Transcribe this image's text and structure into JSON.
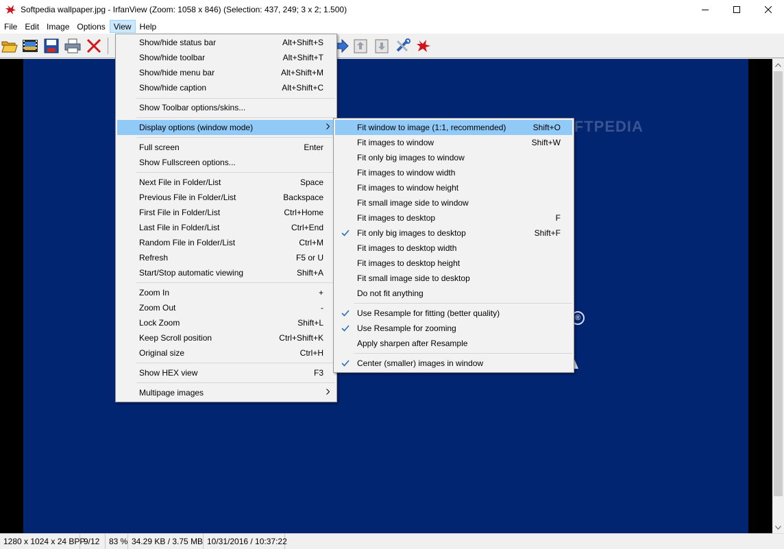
{
  "titlebar": {
    "title": "Softpedia wallpaper.jpg - IrfanView (Zoom: 1058 x 846) (Selection: 437, 249; 3 x 2; 1.500)"
  },
  "menubar": [
    "File",
    "Edit",
    "Image",
    "Options",
    "View",
    "Help"
  ],
  "toolbar": {
    "icons": [
      "open-folder-icon",
      "slideshow-icon",
      "save-icon",
      "print-icon",
      "delete-icon",
      "next-arrow-icon",
      "copy-icon",
      "paste-icon",
      "tools-icon",
      "irfanview-icon"
    ]
  },
  "view_menu": [
    {
      "label": "Show/hide status bar",
      "shortcut": "Alt+Shift+S"
    },
    {
      "label": "Show/hide toolbar",
      "shortcut": "Alt+Shift+T"
    },
    {
      "label": "Show/hide menu bar",
      "shortcut": "Alt+Shift+M"
    },
    {
      "label": "Show/hide caption",
      "shortcut": "Alt+Shift+C"
    },
    {
      "label": "Show Toolbar options/skins...",
      "shortcut": ""
    },
    {
      "label": "Display options (window mode)",
      "shortcut": ""
    },
    {
      "label": "Full screen",
      "shortcut": "Enter"
    },
    {
      "label": "Show Fullscreen options...",
      "shortcut": ""
    },
    {
      "label": "Next File in Folder/List",
      "shortcut": "Space"
    },
    {
      "label": "Previous File in Folder/List",
      "shortcut": "Backspace"
    },
    {
      "label": "First File in Folder/List",
      "shortcut": "Ctrl+Home"
    },
    {
      "label": "Last File in Folder/List",
      "shortcut": "Ctrl+End"
    },
    {
      "label": "Random File in Folder/List",
      "shortcut": "Ctrl+M"
    },
    {
      "label": "Refresh",
      "shortcut": "F5 or U"
    },
    {
      "label": "Start/Stop automatic viewing",
      "shortcut": "Shift+A"
    },
    {
      "label": "Zoom In",
      "shortcut": "+"
    },
    {
      "label": "Zoom Out",
      "shortcut": "-"
    },
    {
      "label": "Lock Zoom",
      "shortcut": "Shift+L"
    },
    {
      "label": "Keep Scroll position",
      "shortcut": "Ctrl+Shift+K"
    },
    {
      "label": "Original size",
      "shortcut": "Ctrl+H"
    },
    {
      "label": "Show HEX view",
      "shortcut": "F3"
    },
    {
      "label": "Multipage images",
      "shortcut": ""
    }
  ],
  "display_submenu": [
    {
      "label": "Fit window to image (1:1, recommended)",
      "shortcut": "Shift+O",
      "checked": false
    },
    {
      "label": "Fit images to window",
      "shortcut": "Shift+W",
      "checked": false
    },
    {
      "label": "Fit only big images to window",
      "shortcut": "",
      "checked": false
    },
    {
      "label": "Fit images to window width",
      "shortcut": "",
      "checked": false
    },
    {
      "label": "Fit images to window height",
      "shortcut": "",
      "checked": false
    },
    {
      "label": "Fit small image side to window",
      "shortcut": "",
      "checked": false
    },
    {
      "label": "Fit images to desktop",
      "shortcut": "F",
      "checked": false
    },
    {
      "label": "Fit only big images to desktop",
      "shortcut": "Shift+F",
      "checked": true
    },
    {
      "label": "Fit images to desktop width",
      "shortcut": "",
      "checked": false
    },
    {
      "label": "Fit images to desktop height",
      "shortcut": "",
      "checked": false
    },
    {
      "label": "Fit small image side to desktop",
      "shortcut": "",
      "checked": false
    },
    {
      "label": "Do not fit anything",
      "shortcut": "",
      "checked": false
    },
    {
      "label": "Use Resample for fitting (better quality)",
      "shortcut": "",
      "checked": true
    },
    {
      "label": "Use Resample for zooming",
      "shortcut": "",
      "checked": true
    },
    {
      "label": "Apply sharpen after Resample",
      "shortcut": "",
      "checked": false
    },
    {
      "label": "Center (smaller) images in window",
      "shortcut": "",
      "checked": true
    }
  ],
  "image": {
    "watermark": "SOFTPEDIA",
    "registered_mark": "®"
  },
  "statusbar": {
    "dimensions": "1280 x 1024 x 24 BPP",
    "index": "9/12",
    "zoom": "83 %",
    "size": "34.29 KB / 3.75 MB",
    "datetime": "10/31/2016 / 10:37:22"
  },
  "colors": {
    "wallpaper_bg": "#022571",
    "menu_highlight": "#91c9f7",
    "checkmark": "#2a6ebb"
  }
}
